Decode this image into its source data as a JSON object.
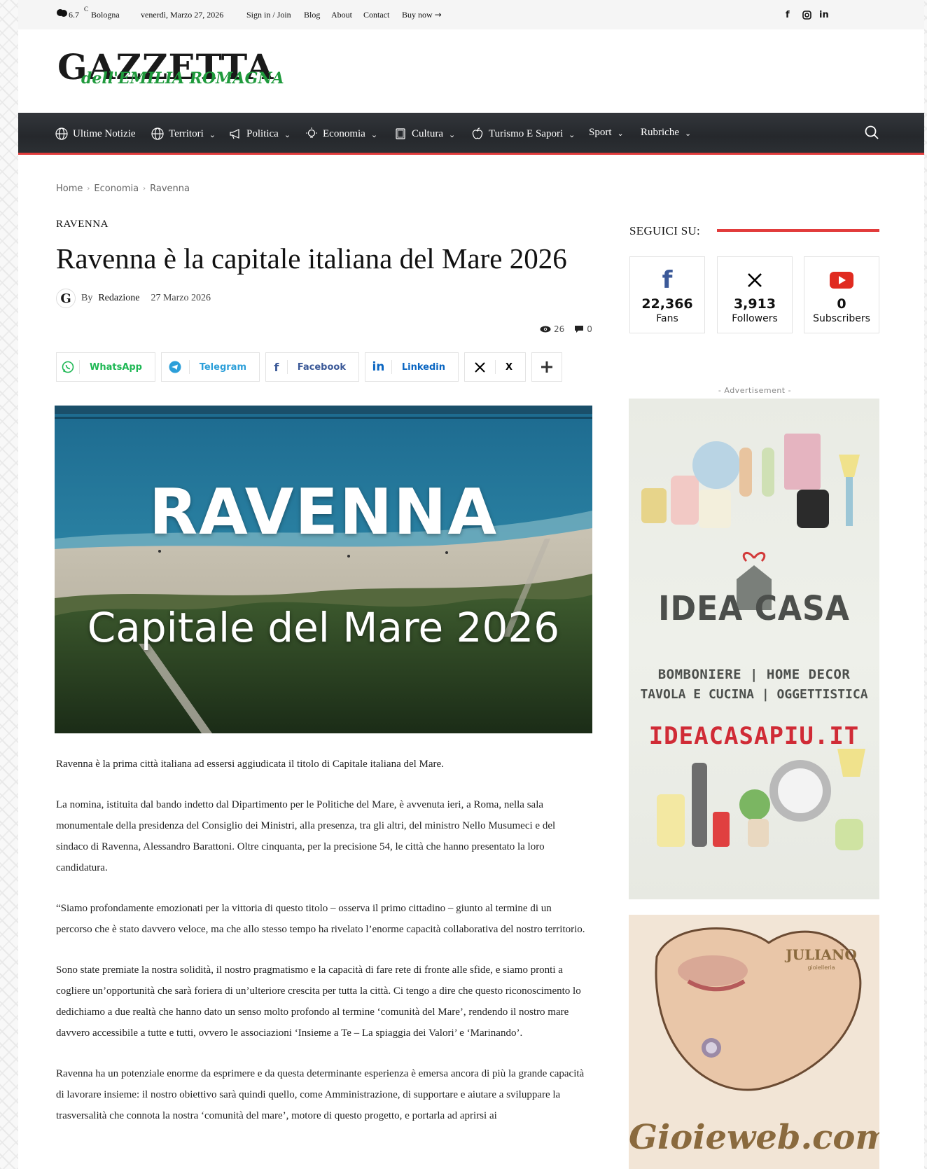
{
  "topbar": {
    "temperature": "6.7",
    "temp_unit": "C",
    "city": "Bologna",
    "date": "venerdì, Marzo 27, 2026",
    "signin": "Sign in / Join",
    "links": [
      "Blog",
      "About",
      "Contact"
    ],
    "buy_now": "Buy now",
    "social_icons": [
      "facebook-icon",
      "instagram-icon",
      "linkedin-icon"
    ]
  },
  "logo": {
    "main": "GAZZETTA",
    "sub": "dell'EMILIA ROMAGNA"
  },
  "nav": {
    "items": [
      {
        "label": "Ultime Notizie",
        "icon": "globe-icon",
        "dropdown": false
      },
      {
        "label": "Territori",
        "icon": "globe-icon",
        "dropdown": true
      },
      {
        "label": "Politica",
        "icon": "megaphone-icon",
        "dropdown": true
      },
      {
        "label": "Economia",
        "icon": "lightbulb-icon",
        "dropdown": true
      },
      {
        "label": "Cultura",
        "icon": "book-icon",
        "dropdown": true
      },
      {
        "label": "Turismo E Sapori",
        "icon": "apple-icon",
        "dropdown": true
      },
      {
        "label": "Sport",
        "icon": "",
        "dropdown": true
      },
      {
        "label": "Rubriche",
        "icon": "",
        "dropdown": true
      }
    ],
    "accent_color": "#e23b3b"
  },
  "breadcrumb": [
    "Home",
    "Economia",
    "Ravenna"
  ],
  "article": {
    "category": "RAVENNA",
    "title": "Ravenna è la capitale italiana del Mare 2026",
    "author_by": "By",
    "author": "Redazione",
    "date": "27 Marzo 2026",
    "views": "26",
    "comments": "0",
    "share": [
      {
        "label": "WhatsApp",
        "icon": "whatsapp-icon",
        "color": "#1fb855"
      },
      {
        "label": "Telegram",
        "icon": "telegram-icon",
        "color": "#2c9fd9"
      },
      {
        "label": "Facebook",
        "icon": "facebook-icon",
        "color": "#3b5998"
      },
      {
        "label": "Linkedin",
        "icon": "linkedin-icon",
        "color": "#0a66c2"
      },
      {
        "label": "X",
        "icon": "x-icon",
        "color": "#000000"
      }
    ],
    "hero_title": "RAVENNA",
    "hero_subtitle": "Capitale del Mare 2026",
    "paragraphs": [
      "Ravenna è la prima città italiana ad essersi aggiudicata il titolo di Capitale italiana del Mare.",
      "La nomina, istituita dal bando indetto dal Dipartimento per le Politiche del Mare, è avvenuta ieri, a Roma, nella sala monumentale della presidenza del Consiglio dei Ministri, alla presenza, tra gli altri, del ministro Nello Musumeci e del sindaco di Ravenna, Alessandro Barattoni. Oltre cinquanta, per la precisione 54, le città che hanno presentato la loro candidatura.",
      "“Siamo profondamente emozionati per la vittoria di questo titolo – osserva il primo cittadino – giunto al termine di un percorso che è stato davvero veloce, ma che allo stesso tempo ha rivelato l’enorme capacità collaborativa del nostro territorio.",
      "Sono state premiate la nostra solidità, il nostro pragmatismo e la capacità di fare rete di fronte alle sfide, e siamo pronti a cogliere un’opportunità che sarà foriera di un’ulteriore crescita per tutta la città. Ci tengo a dire che questo riconoscimento lo dedichiamo a due realtà che hanno dato un senso molto profondo al termine ‘comunità del Mare’, rendendo il nostro mare davvero accessibile a tutte e tutti, ovvero le associazioni ‘Insieme a Te – La spiaggia dei Valori’ e ‘Marinando’.",
      "Ravenna ha un potenziale enorme da esprimere e da questa determinante esperienza è emersa ancora di più la grande capacità di lavorare insieme: il nostro obiettivo sarà quindi quello, come Amministrazione, di supportare e aiutare a sviluppare la trasversalità che connota la nostra ‘comunità del mare’, motore di questo progetto, e portarla ad aprirsi ai"
    ]
  },
  "sidebar": {
    "follow_title": "SEGUICI SU:",
    "follow": [
      {
        "icon": "facebook-icon",
        "count": "22,366",
        "label": "Fans",
        "color": "#3b5998"
      },
      {
        "icon": "x-icon",
        "count": "3,913",
        "label": "Followers",
        "color": "#000000"
      },
      {
        "icon": "youtube-icon",
        "count": "0",
        "label": "Subscribers",
        "color": "#e02b20"
      }
    ],
    "ad_label": "- Advertisement -",
    "ad1": {
      "brand": "IDEA CASA",
      "line1": "BOMBONIERE | HOME DECOR",
      "line2": "TAVOLA E CUCINA | OGGETTISTICA",
      "url": "IDEACASAPIU.IT"
    },
    "ad2": {
      "brand": "JULIANO",
      "brand_sub": "gioielleria",
      "site": "Gioieweb.com"
    }
  }
}
